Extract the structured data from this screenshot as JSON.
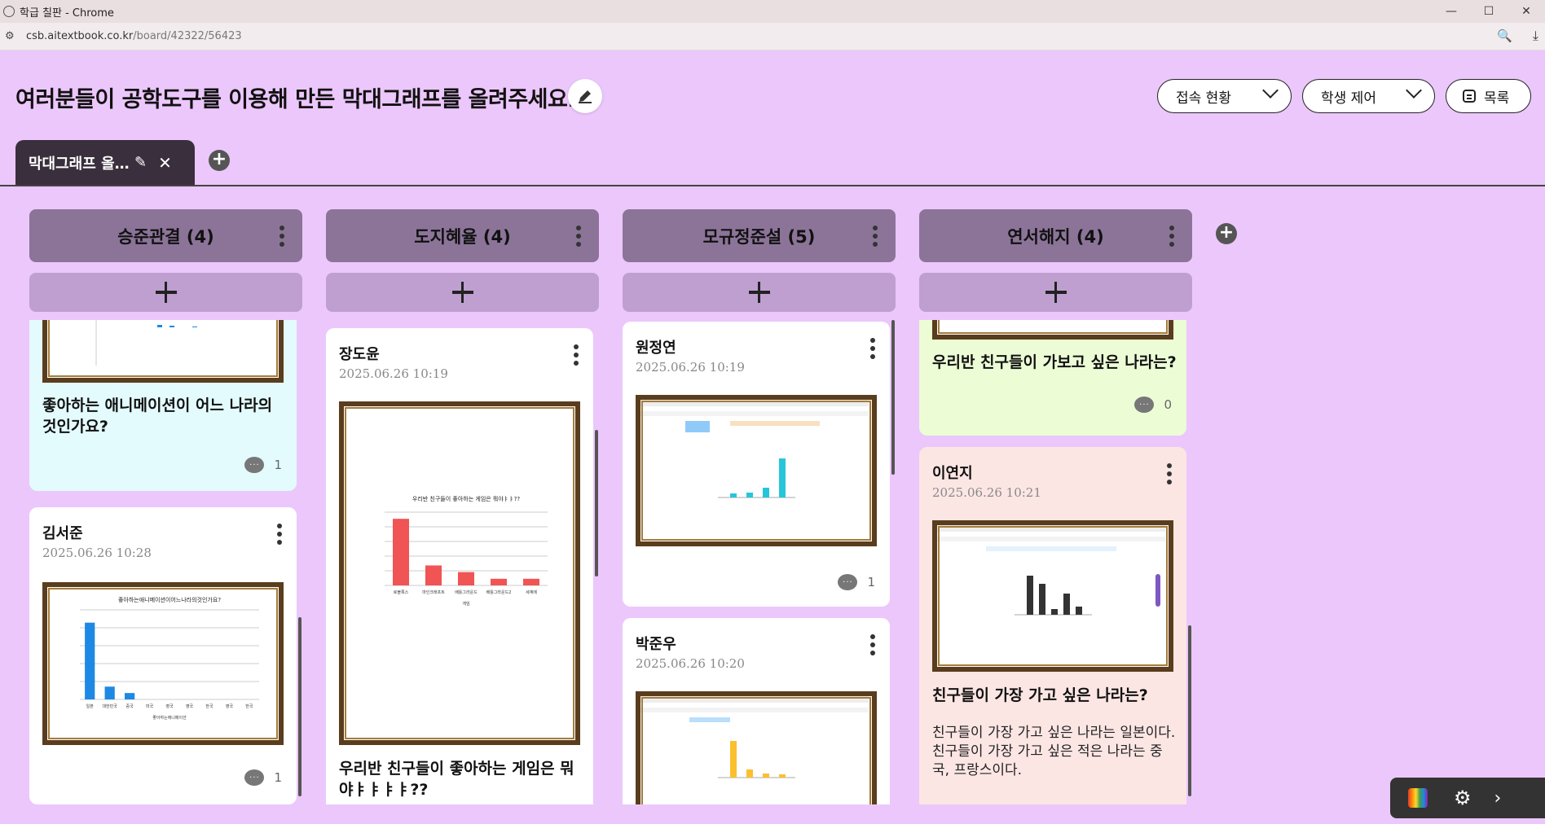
{
  "browser": {
    "window_title": "학급 칠판 - Chrome",
    "url_host": "csb.aitextbook.co.kr",
    "url_path": "/board/42322/56423",
    "controls": {
      "minimize": "—",
      "maximize": "☐",
      "close": "✕"
    }
  },
  "header": {
    "title": "여러분들이 공학도구를 이용해 만든 막대그래프를 올려주세요.",
    "access_label": "접속 현황",
    "control_label": "학생 제어",
    "list_label": "목록"
  },
  "tabs": [
    {
      "label": "막대그래프 올…"
    }
  ],
  "columns": [
    {
      "header": "승준관결 (4)",
      "cards": [
        {
          "title": "좋아하는 애니메이션이 어느 나라의 것인가요?",
          "comments": "1",
          "color": "#e3fbfd"
        },
        {
          "author": "김서준",
          "time": "2025.06.26 10:28",
          "comments": "1",
          "chart_title": "좋아하는애니메이션이어느나라의것인가요?"
        }
      ]
    },
    {
      "header": "도지혜율 (4)",
      "cards": [
        {
          "author": "장도윤",
          "time": "2025.06.26 10:19",
          "title": "우리반 친구들이 좋아하는 게임은 뭐야ㅑㅑㅑㅑ??",
          "chart_title": "우리반 친구들이 좋아하는 게임은 뭐야ㅑㅑ??"
        }
      ]
    },
    {
      "header": "모규정준설 (5)",
      "cards": [
        {
          "author": "원정연",
          "time": "2025.06.26 10:19",
          "comments": "1"
        },
        {
          "author": "박준우",
          "time": "2025.06.26 10:20"
        }
      ]
    },
    {
      "header": "연서해지 (4)",
      "cards": [
        {
          "title": "우리반 친구들이 가보고 싶은 나라는?",
          "comments": "0",
          "color": "#ecfdd6"
        },
        {
          "author": "이연지",
          "time": "2025.06.26 10:21",
          "title": "친구들이 가장 가고 싶은 나라는?",
          "body": "친구들이 가장 가고 싶은 나라는 일본이다. 친구들이 가장 가고 싶은 적은 나라는 중국, 프랑스이다.",
          "color": "#fce6e4"
        }
      ]
    }
  ],
  "chart_data": [
    {
      "type": "bar",
      "title": "좋아하는애니메이션이어느나라의것인가요?",
      "categories": [
        "일본",
        "대한민국",
        "중국",
        "미국",
        "영국",
        "영국",
        "한국",
        "영국",
        "한국"
      ],
      "values": [
        12,
        2,
        1,
        0,
        0,
        0,
        0,
        0,
        0
      ],
      "xlabel": "좋아하는애니메이션",
      "ylim": [
        0,
        14
      ],
      "color": "#1e88e5"
    },
    {
      "type": "bar",
      "title": "우리반 친구들이 좋아하는 게임은 뭐야ㅑㅑ??",
      "categories": [
        "로블록스",
        "마인크래프트",
        "배틀그라운드",
        "배틀그라운드2",
        "세계에"
      ],
      "values": [
        10,
        3,
        2,
        1,
        1
      ],
      "xlabel": "게임",
      "ylim": [
        0,
        11
      ],
      "color": "#f05454"
    }
  ]
}
